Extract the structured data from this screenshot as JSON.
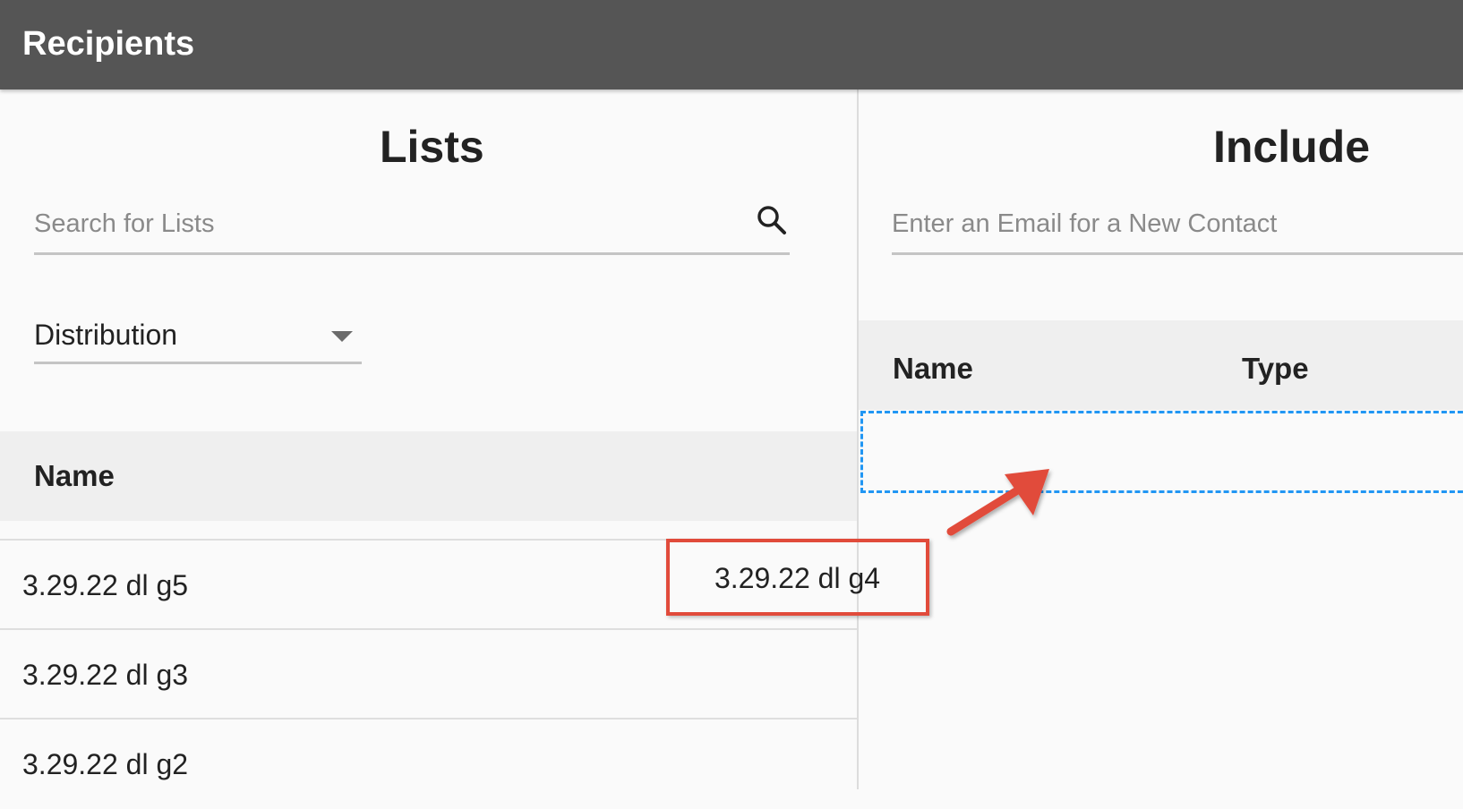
{
  "header": {
    "title": "Recipients"
  },
  "lists_panel": {
    "title": "Lists",
    "search": {
      "placeholder": "Search for Lists",
      "value": "",
      "icon": "search-icon"
    },
    "filter": {
      "selected": "Distribution",
      "icon": "chevron-down-icon"
    },
    "table": {
      "columns": [
        "Name"
      ],
      "rows": [
        {
          "name": "3.29.22 dl g5"
        },
        {
          "name": "3.29.22 dl g3"
        },
        {
          "name": "3.29.22 dl g2"
        }
      ]
    }
  },
  "include_panel": {
    "title": "Include",
    "email": {
      "placeholder": "Enter an Email for a New Contact",
      "value": ""
    },
    "table": {
      "columns": [
        "Name",
        "Type"
      ]
    }
  },
  "drag": {
    "item_label": "3.29.22 dl g4",
    "highlight_color": "#e14b3b",
    "dropzone_color": "#2196f3",
    "arrow_icon": "arrow-icon"
  }
}
